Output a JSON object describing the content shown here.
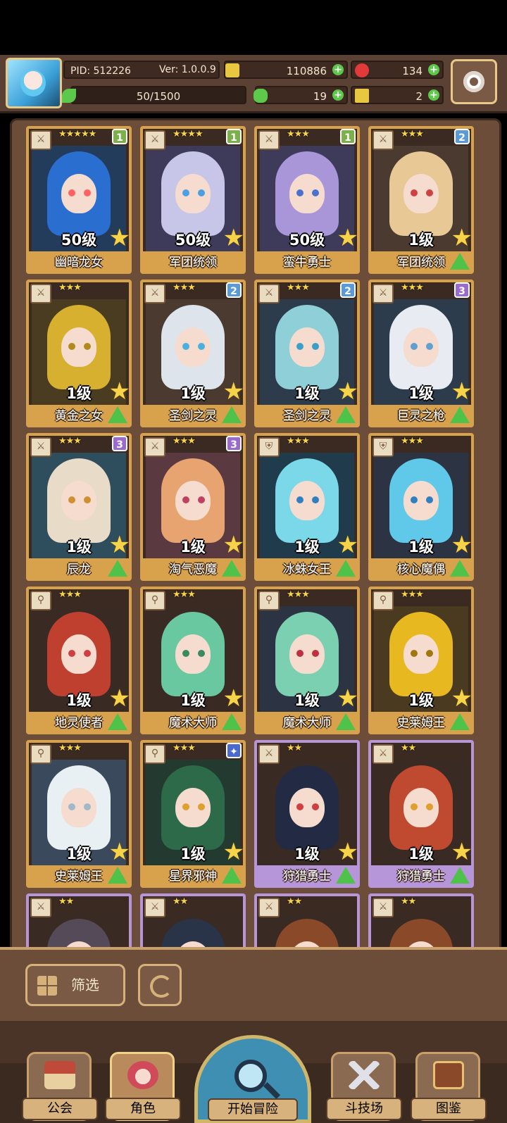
{
  "header": {
    "pid": "PID: 512226",
    "version": "Ver: 1.0.0.9",
    "gold": "110886",
    "gems": "134",
    "energy": "50/1500",
    "clover": "19",
    "keys": "2"
  },
  "characters": [
    {
      "name": "幽暗龙女",
      "level": "50级",
      "stars": "★★★★★",
      "rank": "1",
      "rank_color": "#7bb04a",
      "weapon": "sword",
      "frame": "gold",
      "hair": "#2a6fd0",
      "eye": "#ff6060",
      "bg": "#233c5c",
      "upgradable": false
    },
    {
      "name": "军团统领",
      "level": "50级",
      "stars": "★★★★",
      "rank": "1",
      "rank_color": "#7bb04a",
      "weapon": "sword",
      "frame": "gold",
      "hair": "#c8c6e8",
      "eye": "#4aa0e0",
      "bg": "#3d3a5a",
      "upgradable": false
    },
    {
      "name": "蛮牛勇士",
      "level": "50级",
      "stars": "★★★",
      "rank": "1",
      "rank_color": "#7bb04a",
      "weapon": "sword",
      "frame": "gold",
      "hair": "#a996d8",
      "eye": "#4a70d0",
      "bg": "#3d3a5a",
      "upgradable": false
    },
    {
      "name": "军团统领",
      "level": "1级",
      "stars": "★★★",
      "rank": "2",
      "rank_color": "#5a9ad8",
      "weapon": "sword",
      "frame": "gold",
      "hair": "#e8c894",
      "eye": "#d04040",
      "bg": "#4a3a30",
      "upgradable": true
    },
    {
      "name": "黄金之女",
      "level": "1级",
      "stars": "★★★",
      "rank": "",
      "rank_color": "",
      "weapon": "sword",
      "frame": "gold",
      "hair": "#d8b030",
      "eye": "#b08a1a",
      "bg": "#4a3c20",
      "upgradable": true
    },
    {
      "name": "圣剑之灵",
      "level": "1级",
      "stars": "★★★",
      "rank": "2",
      "rank_color": "#5a9ad8",
      "weapon": "sword",
      "frame": "gold",
      "hair": "#dde4ec",
      "eye": "#4ab0e0",
      "bg": "#4a3a30",
      "upgradable": true
    },
    {
      "name": "圣剑之灵",
      "level": "1级",
      "stars": "★★★",
      "rank": "2",
      "rank_color": "#5a9ad8",
      "weapon": "sword",
      "frame": "gold",
      "hair": "#8fcfd8",
      "eye": "#3aa0c8",
      "bg": "#2c3c4c",
      "upgradable": true
    },
    {
      "name": "巨灵之枪",
      "level": "1级",
      "stars": "★★★",
      "rank": "3",
      "rank_color": "#9a6ad0",
      "weapon": "sword",
      "frame": "gold",
      "hair": "#e8ecf2",
      "eye": "#60a0d0",
      "bg": "#2c3c4c",
      "upgradable": true
    },
    {
      "name": "辰龙",
      "level": "1级",
      "stars": "★★★",
      "rank": "3",
      "rank_color": "#9a6ad0",
      "weapon": "sword",
      "frame": "gold",
      "hair": "#e8dcc8",
      "eye": "#d09030",
      "bg": "#2e4e5e",
      "upgradable": true
    },
    {
      "name": "淘气恶魔",
      "level": "1级",
      "stars": "★★★",
      "rank": "3",
      "rank_color": "#9a6ad0",
      "weapon": "sword",
      "frame": "gold",
      "hair": "#e8a470",
      "eye": "#c04060",
      "bg": "#5a3a40",
      "upgradable": true
    },
    {
      "name": "冰蛛女王",
      "level": "1级",
      "stars": "★★★",
      "rank": "",
      "rank_color": "",
      "weapon": "shield",
      "frame": "gold",
      "hair": "#7ad8e8",
      "eye": "#3080c0",
      "bg": "#203c4c",
      "upgradable": true
    },
    {
      "name": "核心魔偶",
      "level": "1级",
      "stars": "★★★",
      "rank": "",
      "rank_color": "",
      "weapon": "shield",
      "frame": "gold",
      "hair": "#60c8e8",
      "eye": "#3080c0",
      "bg": "#2c3444",
      "upgradable": true
    },
    {
      "name": "地灵使者",
      "level": "1级",
      "stars": "★★★",
      "rank": "",
      "rank_color": "",
      "weapon": "staff",
      "frame": "gold",
      "hair": "#c04030",
      "eye": "#d04040",
      "bg": "#3a2a24",
      "upgradable": true
    },
    {
      "name": "魔术大师",
      "level": "1级",
      "stars": "★★★",
      "rank": "",
      "rank_color": "",
      "weapon": "staff",
      "frame": "gold",
      "hair": "#6ac8a0",
      "eye": "#3a8a60",
      "bg": "#3a2a24",
      "upgradable": true
    },
    {
      "name": "魔术大师",
      "level": "1级",
      "stars": "★★★",
      "rank": "",
      "rank_color": "",
      "weapon": "staff",
      "frame": "gold",
      "hair": "#7ad0b0",
      "eye": "#c03040",
      "bg": "#2c3444",
      "upgradable": true
    },
    {
      "name": "史莱姆王",
      "level": "1级",
      "stars": "★★★",
      "rank": "",
      "rank_color": "",
      "weapon": "staff",
      "frame": "gold",
      "hair": "#e8b820",
      "eye": "#a07810",
      "bg": "#4a3a20",
      "upgradable": true
    },
    {
      "name": "史莱姆王",
      "level": "1级",
      "stars": "★★★",
      "rank": "",
      "rank_color": "",
      "weapon": "staff",
      "frame": "gold",
      "hair": "#e8f0f4",
      "eye": "#a0b8c8",
      "bg": "#3a4a5c",
      "upgradable": true
    },
    {
      "name": "星界邪神",
      "level": "1级",
      "stars": "★★★",
      "rank": "✦",
      "rank_color": "#4a6ad0",
      "weapon": "staff",
      "frame": "gold",
      "hair": "#2c6a4a",
      "eye": "#e0a030",
      "bg": "#223a30",
      "upgradable": true
    },
    {
      "name": "狩猎勇士",
      "level": "1级",
      "stars": "★★",
      "rank": "",
      "rank_color": "",
      "weapon": "sword",
      "frame": "purple",
      "hair": "#222a44",
      "eye": "#d04040",
      "bg": "#3a2a24",
      "upgradable": true
    },
    {
      "name": "狩猎勇士",
      "level": "1级",
      "stars": "★★",
      "rank": "",
      "rank_color": "",
      "weapon": "sword",
      "frame": "purple",
      "hair": "#c04a30",
      "eye": "#e0a030",
      "bg": "#3a2a24",
      "upgradable": true
    },
    {
      "name": "",
      "level": "",
      "stars": "★★",
      "rank": "",
      "rank_color": "",
      "weapon": "sword",
      "frame": "purple",
      "hair": "#554a58",
      "eye": "#d04040",
      "bg": "#3a2a24",
      "upgradable": false
    },
    {
      "name": "",
      "level": "",
      "stars": "★★",
      "rank": "",
      "rank_color": "",
      "weapon": "sword",
      "frame": "purple",
      "hair": "#2a3448",
      "eye": "#d04040",
      "bg": "#3a2a24",
      "upgradable": false
    },
    {
      "name": "",
      "level": "",
      "stars": "★★",
      "rank": "",
      "rank_color": "",
      "weapon": "sword",
      "frame": "purple",
      "hair": "#8a4a2a",
      "eye": "#d04040",
      "bg": "#3a2a24",
      "upgradable": false
    },
    {
      "name": "",
      "level": "",
      "stars": "★★",
      "rank": "",
      "rank_color": "",
      "weapon": "sword",
      "frame": "purple",
      "hair": "#8a4a2a",
      "eye": "#d04040",
      "bg": "#3a2a24",
      "upgradable": false
    }
  ],
  "toolbar": {
    "filter_label": "筛选"
  },
  "nav": {
    "guild": "公会",
    "roles": "角色",
    "adventure": "开始冒险",
    "arena": "斗技场",
    "codex": "图鉴"
  },
  "colors": {
    "accent": "#d8a24c",
    "panel": "#6b4d3a",
    "green_plus": "#5cc94a"
  }
}
